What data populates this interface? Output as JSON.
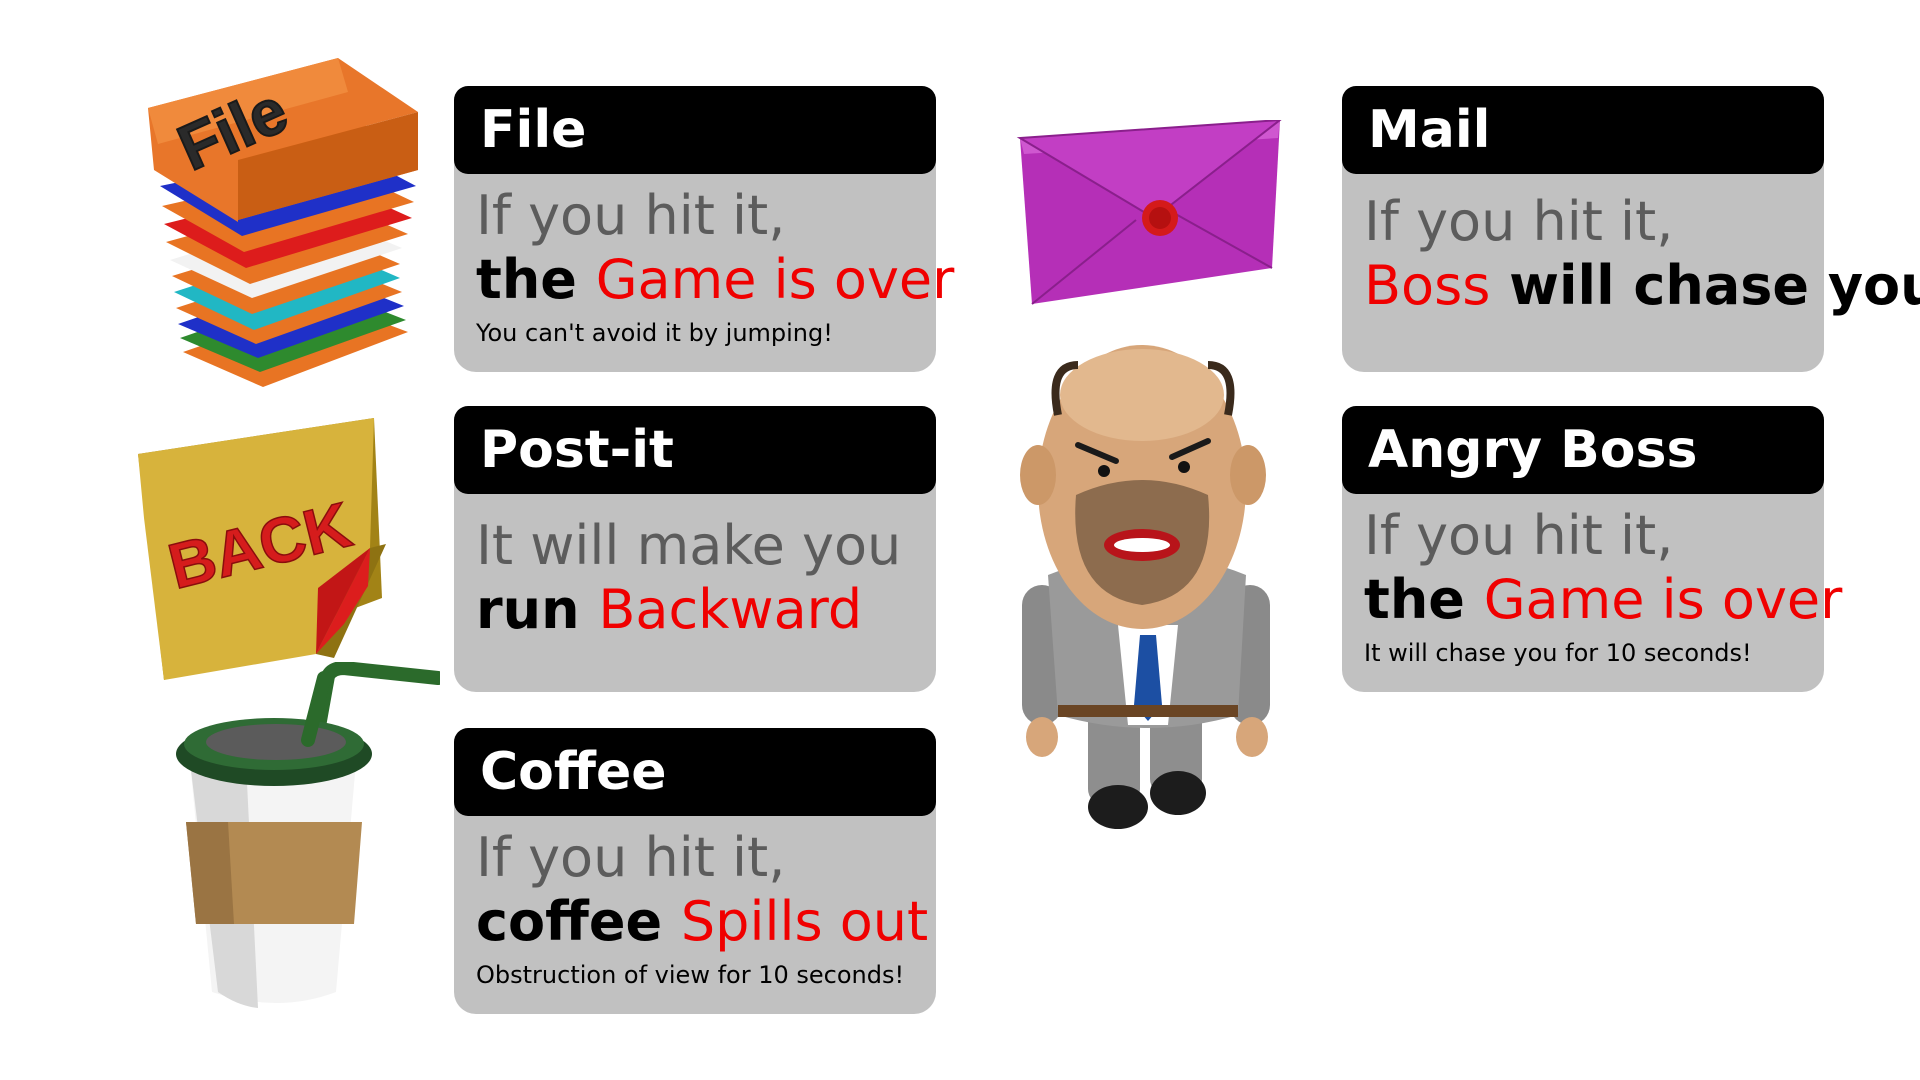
{
  "items": [
    {
      "key": "file",
      "title": "File",
      "line1": "If you hit it,",
      "line2_plain": "the ",
      "line2_highlight": "Game is over",
      "note": "You can't avoid it by jumping!",
      "icon": "file-stack-icon",
      "label_on_icon": "File"
    },
    {
      "key": "postit",
      "title": "Post-it",
      "line1": "It will make you",
      "line2_plain": "run ",
      "line2_highlight": "Backward",
      "icon": "post-it-icon",
      "label_on_icon": "BACK"
    },
    {
      "key": "coffee",
      "title": "Coffee",
      "line1": "If you hit it,",
      "line2_plain": "coffee ",
      "line2_highlight": "Spills out",
      "note": "Obstruction of view for 10 seconds!",
      "icon": "coffee-cup-icon"
    },
    {
      "key": "mail",
      "title": "Mail",
      "line1": "If you hit it,",
      "line2_highlight": "Boss",
      "line2_plain_after": " will chase you",
      "icon": "envelope-icon"
    },
    {
      "key": "boss",
      "title": "Angry Boss",
      "line1": "If you hit it,",
      "line2_plain": "the ",
      "line2_highlight": "Game is over",
      "note": "It will chase you for 10 seconds!",
      "icon": "angry-boss-character"
    }
  ],
  "colors": {
    "header_bg": "#000000",
    "header_text": "#ffffff",
    "card_bg": "#c1c1c1",
    "highlight": "#f00000",
    "muted_text": "#5c5c5c"
  }
}
